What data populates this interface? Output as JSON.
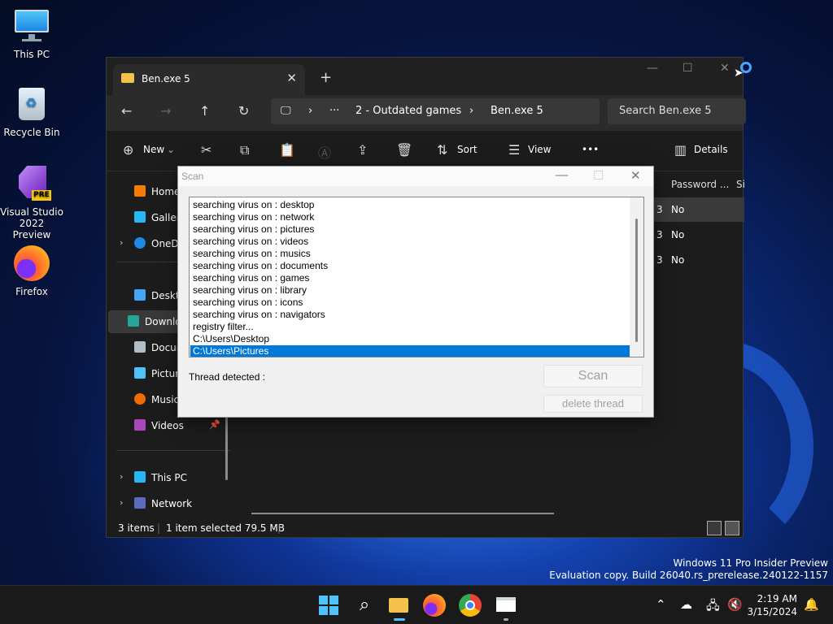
{
  "desktop": {
    "icons": [
      {
        "label": "This PC"
      },
      {
        "label": "Recycle Bin"
      },
      {
        "label": "Visual Studio 2022 Preview",
        "badge": "PRE"
      },
      {
        "label": "Firefox"
      }
    ]
  },
  "explorer": {
    "tab_title": "Ben.exe 5",
    "new_tab": "+",
    "tab_close": "✕",
    "window_buttons": {
      "minimize": "—",
      "maximize": "☐",
      "close": "✕"
    },
    "address": {
      "ellipsis": "···",
      "crumb1": "2 - Outdated games",
      "crumb2": "Ben.exe 5",
      "sep": "›"
    },
    "search_placeholder": "Search Ben.exe 5",
    "toolbar": {
      "new": "New",
      "sort": "Sort",
      "view": "View",
      "more": "•••",
      "details": "Details"
    },
    "sidebar": [
      {
        "label": "Home"
      },
      {
        "label": "Gallery"
      },
      {
        "label": "OneDrive"
      },
      {
        "label": "Desktop"
      },
      {
        "label": "Downloads"
      },
      {
        "label": "Documents"
      },
      {
        "label": "Pictures"
      },
      {
        "label": "Music"
      },
      {
        "label": "Videos"
      },
      {
        "label": "This PC"
      },
      {
        "label": "Network"
      }
    ],
    "columns": {
      "password": "Password ...",
      "size": "Si"
    },
    "rows": [
      {
        "frag": "3",
        "password": "No"
      },
      {
        "frag": "3",
        "password": "No"
      },
      {
        "frag": "3",
        "password": "No"
      }
    ],
    "status": {
      "items": "3 items",
      "selected": "1 item selected  79.5 MB"
    }
  },
  "scan_dialog": {
    "title": "Scan",
    "log_lines": [
      "searching virus on : desktop",
      "searching virus on : network",
      "searching virus on : pictures",
      "searching virus on : videos",
      "searching virus on : musics",
      "searching virus on : documents",
      "searching virus on : games",
      "searching virus on : library",
      "searching virus on : icons",
      "searching virus on : navigators",
      "registry filter...",
      "C:\\Users\\Desktop",
      "C:\\Users\\Pictures"
    ],
    "selected_line": "C:\\Users\\Pictures",
    "thread_label": "Thread detected :",
    "scan_button": "Scan",
    "delete_button": "delete thread"
  },
  "watermark": {
    "line1": "Windows 11 Pro Insider Preview",
    "line2": "Evaluation copy. Build 26040.rs_prerelease.240122-1157"
  },
  "taskbar": {
    "time": "2:19 AM",
    "date": "3/15/2024"
  },
  "colors": {
    "accent": "#0078d7",
    "explorer_bg": "#1c1c1c",
    "taskbar_bg": "#1a1a1a"
  }
}
